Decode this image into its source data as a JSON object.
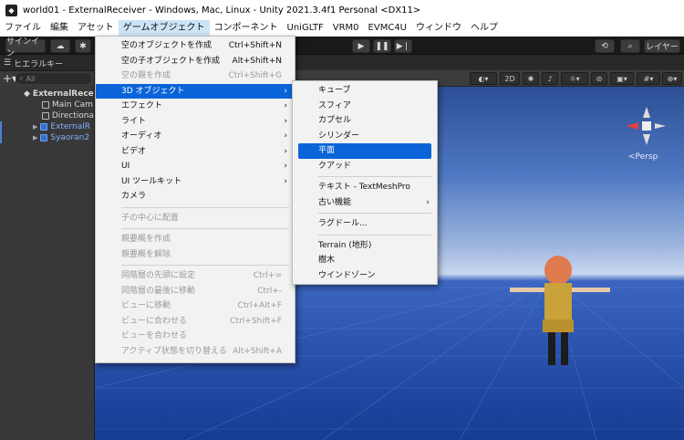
{
  "window": {
    "title": "world01 - ExternalReceiver - Windows, Mac, Linux - Unity 2021.3.4f1 Personal <DX11>"
  },
  "menubar": [
    "ファイル",
    "編集",
    "アセット",
    "ゲームオブジェクト",
    "コンポーネント",
    "UniGLTF",
    "VRM0",
    "EVMC4U",
    "ウィンドウ",
    "ヘルプ"
  ],
  "toolbar": {
    "signin": "サインイン",
    "layers": "レイヤー",
    "play_icon": "play-icon",
    "pause_icon": "pause-icon",
    "step_icon": "step-icon"
  },
  "hierarchy": {
    "tab": "ヒエラルキー",
    "search_placeholder": "All",
    "rows": [
      "ExternalRece",
      "Main Cam",
      "Directiona",
      "ExternalR",
      "Syaoran2"
    ]
  },
  "scene": {
    "mode_2d": "2D",
    "persp": "Persp"
  },
  "gameobject_menu": [
    {
      "label": "空のオブジェクトを作成",
      "shortcut": "Ctrl+Shift+N"
    },
    {
      "label": "空の子オブジェクトを作成",
      "shortcut": "Alt+Shift+N"
    },
    {
      "label": "空の親を作成",
      "shortcut": "Ctrl+Shift+G"
    },
    {
      "label": "3D オブジェクト"
    },
    {
      "label": "エフェクト"
    },
    {
      "label": "ライト"
    },
    {
      "label": "オーディオ"
    },
    {
      "label": "ビデオ"
    },
    {
      "label": "UI"
    },
    {
      "label": "UI ツールキット"
    },
    {
      "label": "カメラ"
    },
    {
      "label": "子の中心に配置"
    },
    {
      "label": "親要概を作成"
    },
    {
      "label": "親要概を解除"
    },
    {
      "label": "同階層の先頭に設定",
      "shortcut": "Ctrl+="
    },
    {
      "label": "同階層の最後に移動",
      "shortcut": "Ctrl+-"
    },
    {
      "label": "ビューに移動",
      "shortcut": "Ctrl+Alt+F"
    },
    {
      "label": "ビューに合わせる",
      "shortcut": "Ctrl+Shift+F"
    },
    {
      "label": "ビューを合わせる"
    },
    {
      "label": "アクティブ状態を切り替える",
      "shortcut": "Alt+Shift+A"
    }
  ],
  "submenu_3d": [
    "キューブ",
    "スフィア",
    "カプセル",
    "シリンダー",
    "平面",
    "クアッド",
    "テキスト - TextMeshPro",
    "古い機能",
    "ラグドール...",
    "Terrain (地形)",
    "樹木",
    "ウインドゾーン"
  ],
  "colors": {
    "highlight": "#0a64d8"
  }
}
